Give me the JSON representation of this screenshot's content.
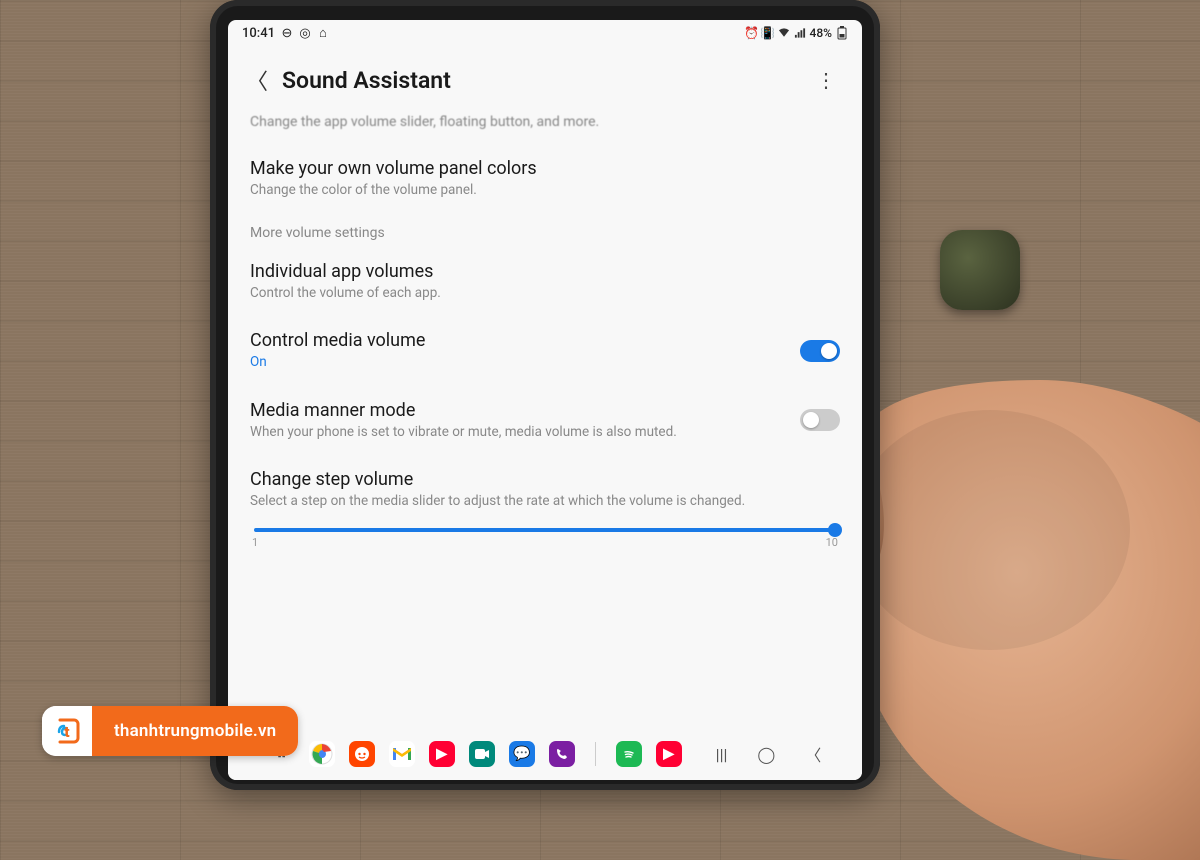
{
  "status": {
    "time": "10:41",
    "battery": "48%"
  },
  "header": {
    "title": "Sound Assistant"
  },
  "truncated_line": "Change the app volume slider, floating button, and more.",
  "rows": {
    "volume_panel": {
      "title": "Make your own volume panel colors",
      "sub": "Change the color of the volume panel."
    },
    "section_more": "More volume settings",
    "individual": {
      "title": "Individual app volumes",
      "sub": "Control the volume of each app."
    },
    "control_media": {
      "title": "Control media volume",
      "sub": "On",
      "on": true
    },
    "media_manner": {
      "title": "Media manner mode",
      "sub": "When your phone is set to vibrate or mute, media volume is also muted.",
      "on": false
    },
    "step_volume": {
      "title": "Change step volume",
      "sub": "Select a step on the media slider to adjust the rate at which the volume is changed.",
      "min": "1",
      "max": "10",
      "value": 10
    }
  },
  "watermark": {
    "text": "thanhtrungmobile.vn"
  }
}
